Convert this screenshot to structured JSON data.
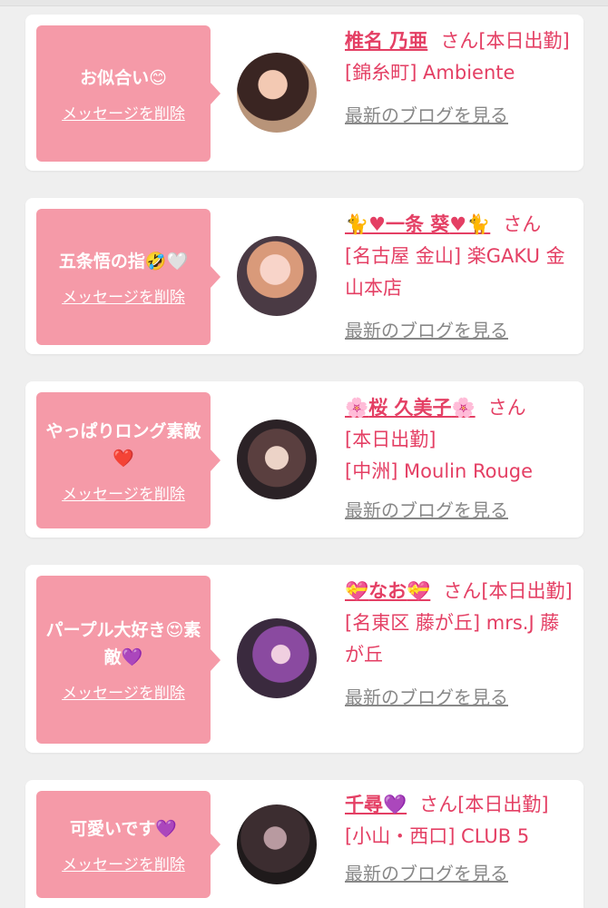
{
  "cards": [
    {
      "message": "お似合い😊",
      "delete_label": "メッセージを削除",
      "name": "椎名 乃亜",
      "name_pre": "",
      "name_post": "",
      "honorific": "さん",
      "shift": "[本日出勤]",
      "shop": "[錦糸町] Ambiente",
      "blog_label": "最新のブログを見る"
    },
    {
      "message": "五条悟の指🤣🤍",
      "delete_label": "メッセージを削除",
      "name": "一条 葵",
      "name_pre": "🐈♥",
      "name_post": "♥🐈",
      "honorific": "さん",
      "shift": "",
      "shop": "[名古屋 金山] 楽GAKU 金山本店",
      "blog_label": "最新のブログを見る"
    },
    {
      "message": "やっぱりロング素敵❤️",
      "delete_label": "メッセージを削除",
      "name": "桜 久美子",
      "name_pre": "🌸",
      "name_post": "🌸",
      "honorific": "さん",
      "shift": "[本日出勤]",
      "shop": "[中洲] Moulin Rouge",
      "blog_label": "最新のブログを見る"
    },
    {
      "message": "パープル大好き😍素敵💜",
      "delete_label": "メッセージを削除",
      "name": "なお",
      "name_pre": "💝",
      "name_post": "💝",
      "honorific": "さん",
      "shift": "[本日出勤]",
      "shop": "[名東区 藤が丘] mrs.J 藤が丘",
      "blog_label": "最新のブログを見る"
    },
    {
      "message": "可愛いです💜",
      "delete_label": "メッセージを削除",
      "name": "千尋",
      "name_pre": "",
      "name_post": "💜",
      "honorific": "さん",
      "shift": "[本日出勤]",
      "shop": "[小山・西口] CLUB 5",
      "blog_label": "最新のブログを見る"
    }
  ],
  "colors": {
    "accent": "#e43f64",
    "bubble": "#f59aa8",
    "link_gray": "#888888",
    "background": "#efefef"
  }
}
